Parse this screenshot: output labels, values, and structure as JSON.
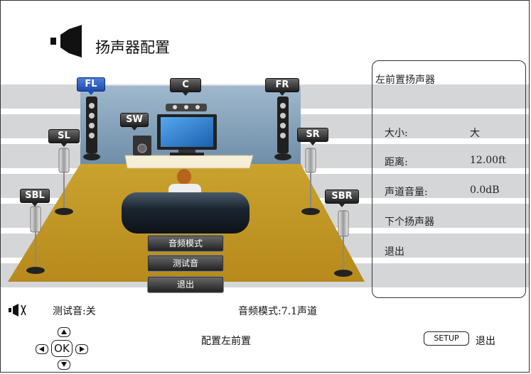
{
  "page": {
    "title": "扬声器配置"
  },
  "speakers": [
    {
      "id": "FL",
      "label": "FL",
      "selected": true
    },
    {
      "id": "C",
      "label": "C",
      "selected": false
    },
    {
      "id": "FR",
      "label": "FR",
      "selected": false
    },
    {
      "id": "SW",
      "label": "SW",
      "selected": false
    },
    {
      "id": "SL",
      "label": "SL",
      "selected": false
    },
    {
      "id": "SR",
      "label": "SR",
      "selected": false
    },
    {
      "id": "SBL",
      "label": "SBL",
      "selected": false
    },
    {
      "id": "SBR",
      "label": "SBR",
      "selected": false
    }
  ],
  "scene_menu": {
    "audio_mode": "音频模式",
    "test_tone": "测试音",
    "exit": "退出"
  },
  "panel": {
    "heading": "左前置扬声器",
    "size_label": "大小:",
    "size_value": "大",
    "distance_label": "距离:",
    "distance_value": "12.00ft",
    "volume_label": "声道音量:",
    "volume_value": "0.0dB",
    "next_speaker": "下个扬声器",
    "exit": "退出"
  },
  "status": {
    "test_tone": "测试音:关",
    "audio_mode": "音频模式:7.1声道"
  },
  "help": {
    "ok_label": "OK",
    "hint": "配置左前置",
    "setup_key": "SETUP",
    "setup_action": "退出"
  },
  "colors": {
    "highlight": "#2a5bc4",
    "stripe": "#d4d6d8",
    "floor": "#c9a02a",
    "wall": "#8aa6bf"
  }
}
